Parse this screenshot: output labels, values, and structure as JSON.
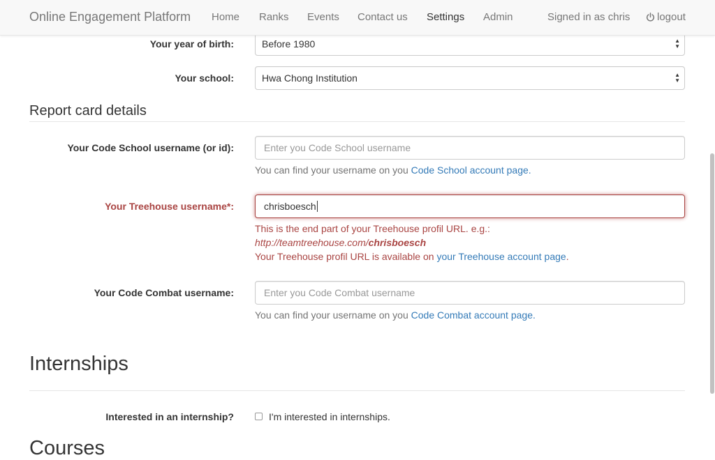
{
  "navbar": {
    "brand": "Online Engagement Platform",
    "links": [
      "Home",
      "Ranks",
      "Events",
      "Contact us",
      "Settings",
      "Admin"
    ],
    "signed_in": "Signed in as chris",
    "logout": "logout"
  },
  "profile": {
    "year_label": "Your year of birth:",
    "year_value": "Before 1980",
    "school_label": "Your school:",
    "school_value": "Hwa Chong Institution"
  },
  "report_card": {
    "heading": "Report card details",
    "codeschool": {
      "label": "Your Code School username (or id):",
      "placeholder": "Enter you Code School username",
      "help_prefix": "You can find your username on you ",
      "help_link": "Code School account page."
    },
    "treehouse": {
      "label": "Your Treehouse username*:",
      "value": "chrisboesch",
      "help_line1": "This is the end part of your Treehouse profil URL. e.g.:",
      "help_url_prefix": "http://teamtreehouse.com/",
      "help_url_bold": "chrisboesch",
      "help_line3_prefix": "Your Treehouse profil URL is available on ",
      "help_line3_link": "your Treehouse account page",
      "help_line3_suffix": "."
    },
    "codecombat": {
      "label": "Your Code Combat username:",
      "placeholder": "Enter you Code Combat username",
      "help_prefix": "You can find your username on you ",
      "help_link": "Code Combat account page."
    }
  },
  "internships": {
    "heading": "Internships",
    "label": "Interested in an internship?",
    "checkbox_label": "I'm interested in internships.",
    "checked": false
  },
  "courses": {
    "heading": "Courses"
  },
  "colors": {
    "error": "#a94442",
    "link": "#337ab7",
    "nav_text": "#777777"
  }
}
